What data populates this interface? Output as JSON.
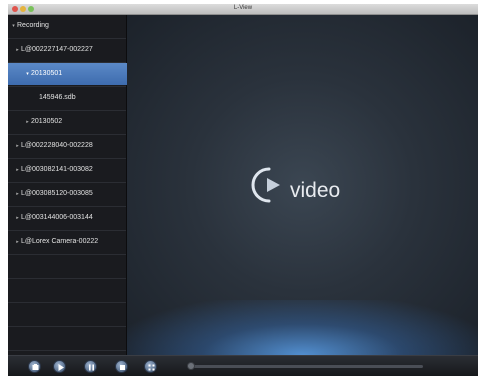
{
  "window": {
    "title": "L-View"
  },
  "sidebar": {
    "items": [
      {
        "label": "Recording",
        "level": 0,
        "expanded": true,
        "selected": false
      },
      {
        "label": "L@002227147-002227",
        "level": 1,
        "expanded": false,
        "selected": false
      },
      {
        "label": "20130501",
        "level": 2,
        "expanded": true,
        "selected": true
      },
      {
        "label": "145946.sdb",
        "level": 3,
        "expanded": false,
        "selected": false
      },
      {
        "label": "20130502",
        "level": 2,
        "expanded": false,
        "selected": false
      },
      {
        "label": "L@002228040-002228",
        "level": 1,
        "expanded": false,
        "selected": false
      },
      {
        "label": "L@003082141-003082",
        "level": 1,
        "expanded": false,
        "selected": false
      },
      {
        "label": "L@003085120-003085",
        "level": 1,
        "expanded": false,
        "selected": false
      },
      {
        "label": "L@003144006-003144",
        "level": 1,
        "expanded": false,
        "selected": false
      },
      {
        "label": "L@Lorex Camera-00222",
        "level": 1,
        "expanded": false,
        "selected": false
      }
    ]
  },
  "video": {
    "logo_text": "video"
  },
  "controls": {
    "buttons": [
      "snapshot-icon",
      "play-icon",
      "pause-icon",
      "stop-icon",
      "fullscreen-icon"
    ],
    "progress": 0.0
  },
  "colors": {
    "selection": "#4a78b9",
    "glow": "#5aa0eb",
    "background": "#1b1d22"
  }
}
